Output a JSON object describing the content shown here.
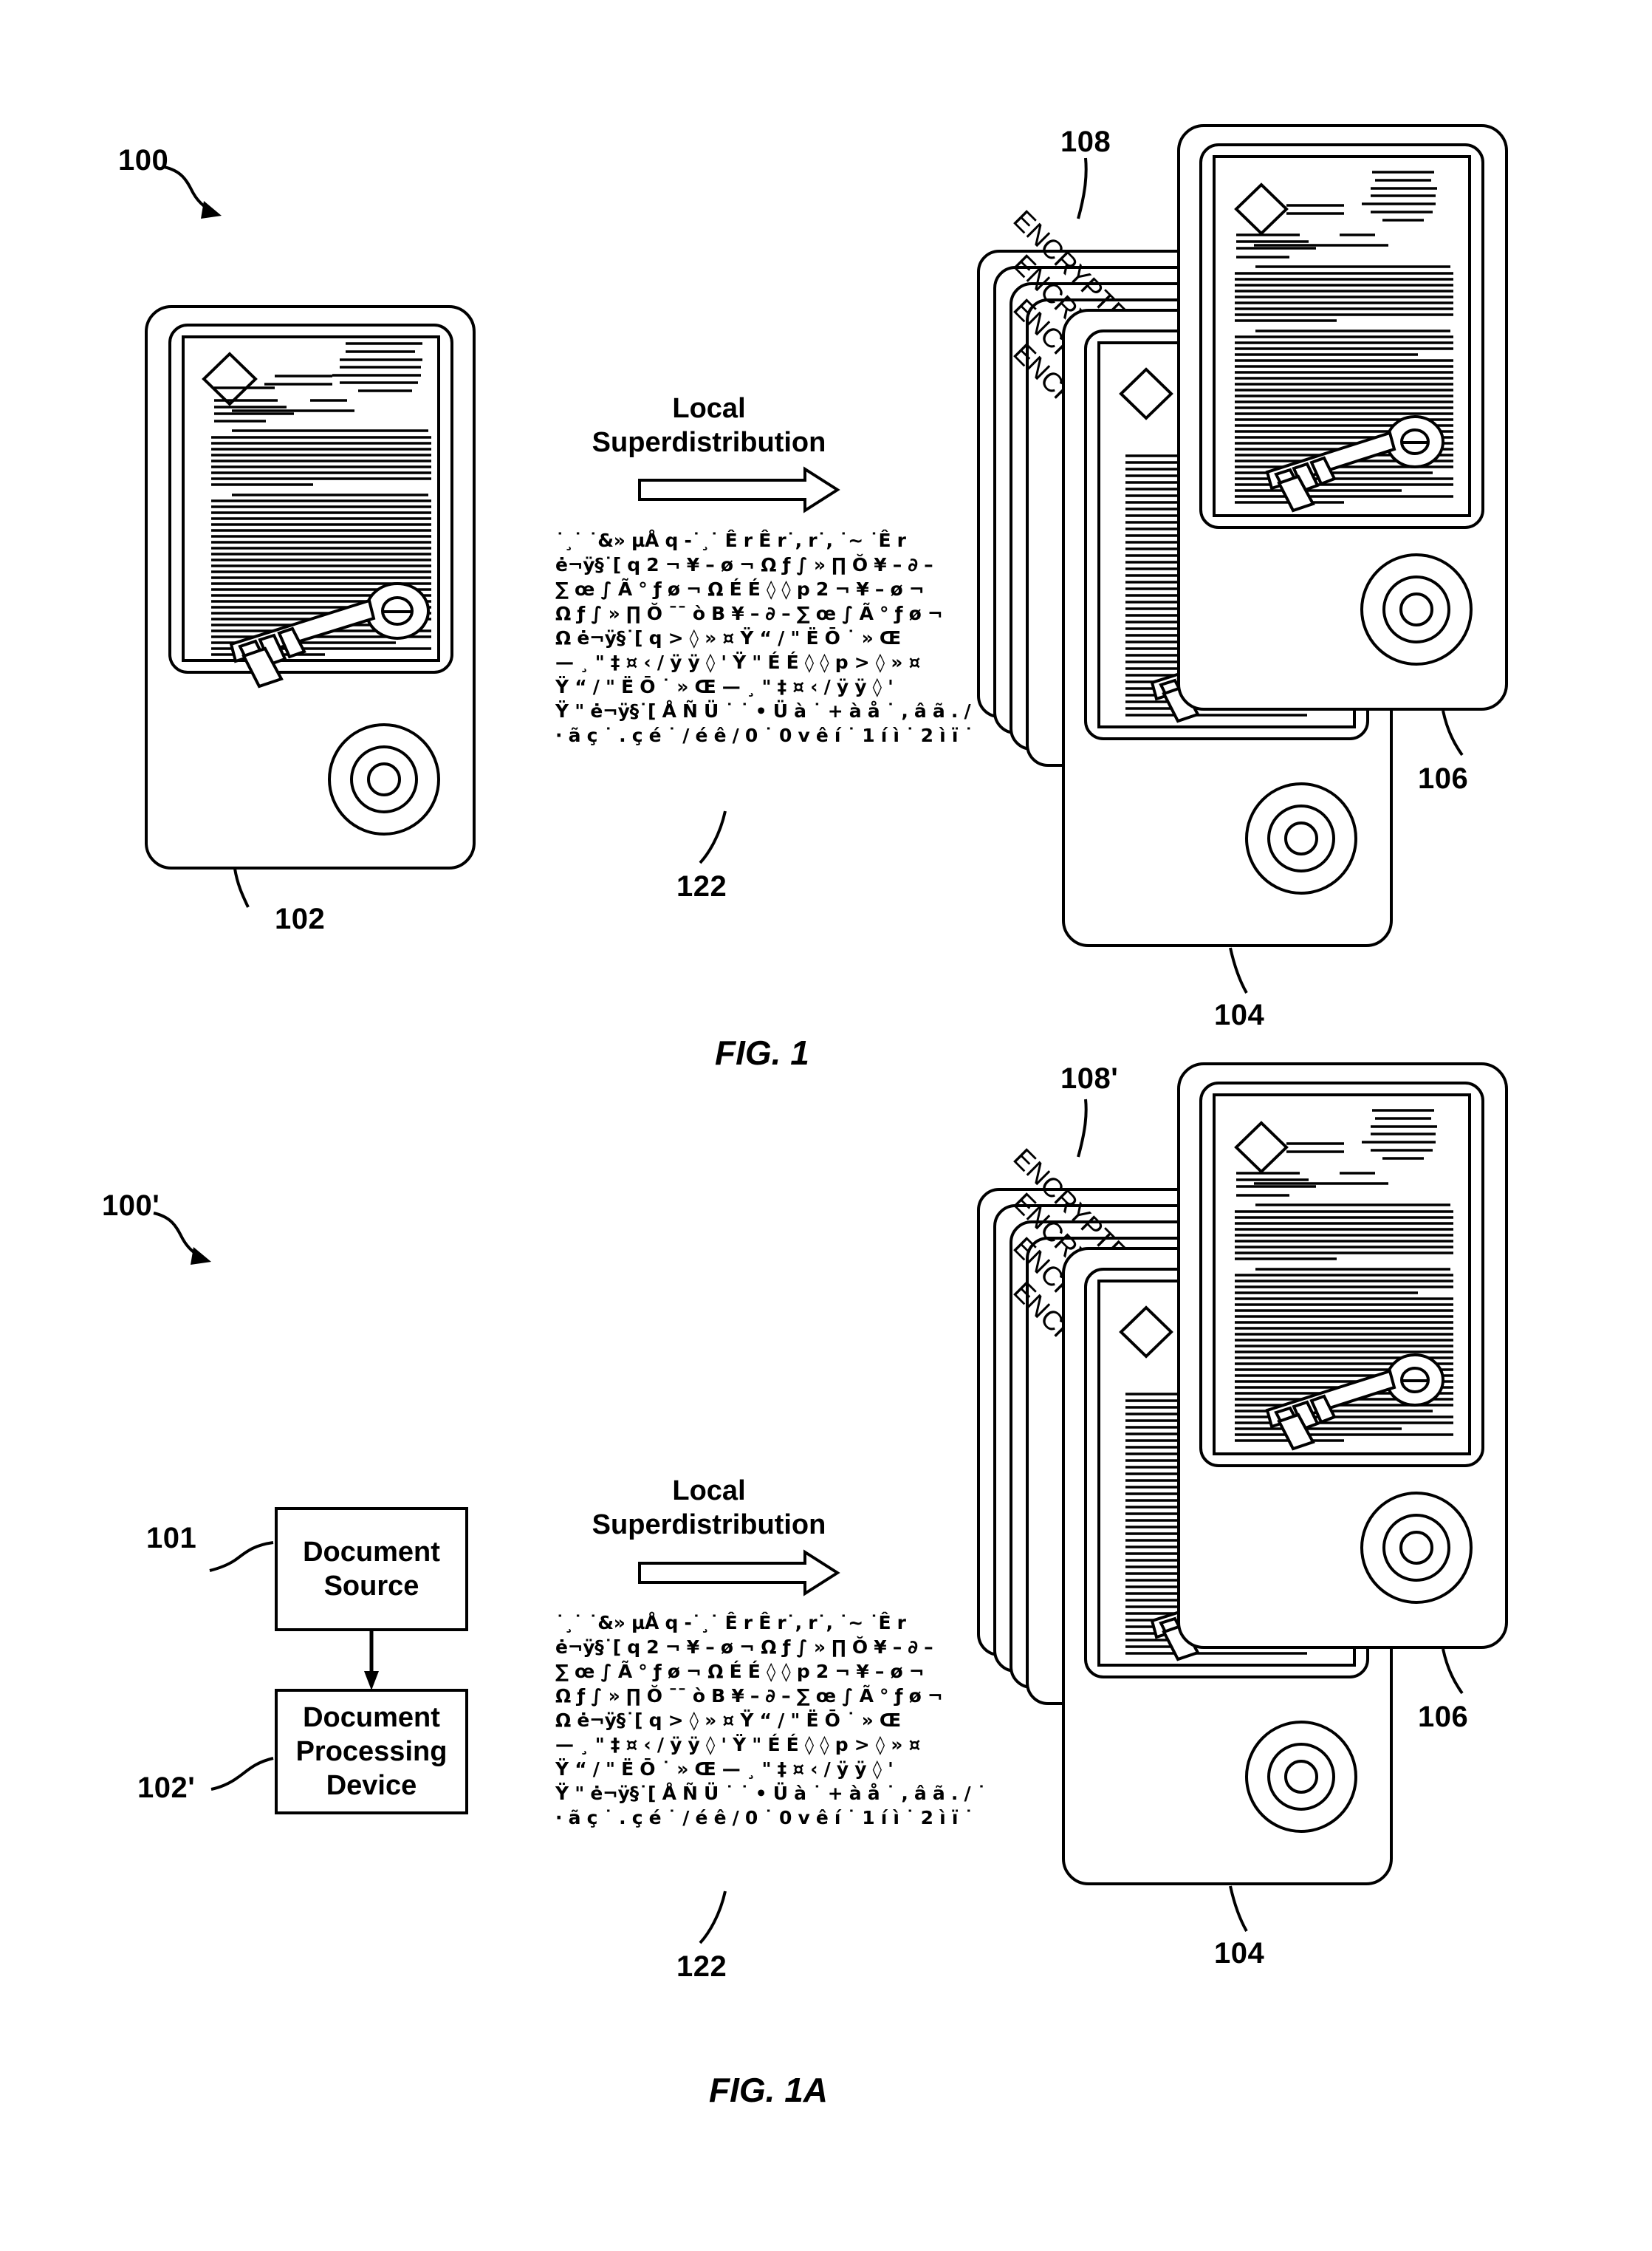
{
  "figures": [
    {
      "id": "fig1",
      "caption": "FIG. 1",
      "system_ref": "100",
      "source_device_ref": "102",
      "target_device_ref": "104",
      "top_device_ref": "106",
      "encrypted_stack_ref": "108",
      "cipher_ref": "122",
      "distribution_label_line1": "Local",
      "distribution_label_line2": "Superdistribution",
      "encrypted_stack_labels": [
        "ENCRYPTED",
        "ENCRYPT",
        "ENCR",
        "ENCR"
      ],
      "cipher_lines": [
        "˙¸˙ ˙&» µÅ q -˙¸˙ Ê r Ê r˙, r˙, ˙~ ˙Ê r",
        "ė¬ÿ§˙[ q 2 ¬ ¥ – ø ¬ Ω ƒ ∫ » ∏ Ŏ ¥ – ∂ –",
        "∑ œ ∫ Ã ° ƒ ø ¬ Ω  É É ◊ ◊ p 2 ¬ ¥ – ø ¬",
        "Ω ƒ ∫ » ∏ Ŏ ¯¯ ò B ¥ – ∂ – ∑ œ ∫ Ã ° ƒ ø ¬",
        "Ω  ė¬ÿ§˙[ q > ◊ »  ¤ Ÿ “ / \" Ë Ō ˙ »    Œ",
        "— ¸ \" ‡ ¤ ‹ / ÿ ÿ ◊ ' Ÿ \"  É É ◊ ◊ p > ◊ »  ¤",
        "Ÿ “ / \" Ë Ō ˙ »    Œ  — ¸ \" ‡ ¤ ‹ / ÿ ÿ ◊ '",
        "Ÿ \"  ė¬ÿ§˙[ Å Ñ Ü ˙ ˙ • Ü à ˙ + à å ˙ , â ã . / ˙",
        "· ã ç ˙ . ç é ˙ / é ê / 0 ˙ 0 v ê í ˙ 1 í ì ˙ 2 ì ï ˙"
      ]
    },
    {
      "id": "fig1a",
      "caption": "FIG. 1A",
      "system_ref": "100'",
      "document_source_ref": "101",
      "document_source_label_line1": "Document",
      "document_source_label_line2": "Source",
      "processing_device_ref": "102'",
      "processing_device_label_line1": "Document",
      "processing_device_label_line2": "Processing",
      "processing_device_label_line3": "Device",
      "target_device_ref": "104",
      "top_device_ref": "106",
      "encrypted_stack_ref": "108'",
      "cipher_ref": "122",
      "distribution_label_line1": "Local",
      "distribution_label_line2": "Superdistribution",
      "encrypted_stack_labels": [
        "ENCRYPTED",
        "ENCRYPT",
        "ENCR",
        "ENCR"
      ],
      "cipher_lines": [
        "˙¸˙ ˙&» µÅ q -˙¸˙ Ê r Ê r˙, r˙, ˙~ ˙Ê r",
        "ė¬ÿ§˙[ q 2 ¬ ¥ – ø ¬ Ω ƒ ∫ » ∏ Ŏ ¥ – ∂ –",
        "∑ œ ∫ Ã ° ƒ ø ¬ Ω  É É ◊ ◊ p 2 ¬ ¥ – ø ¬",
        "Ω ƒ ∫ » ∏ Ŏ ¯¯ ò B ¥ – ∂ – ∑ œ ∫ Ã ° ƒ ø ¬",
        "Ω  ė¬ÿ§˙[ q > ◊ »  ¤ Ÿ “ / \" Ë Ō ˙ »    Œ",
        "— ¸ \" ‡ ¤ ‹ / ÿ ÿ ◊ ' Ÿ \"  É É ◊ ◊ p > ◊ »  ¤",
        "Ÿ “ / \" Ë Ō ˙ »    Œ  — ¸ \" ‡ ¤ ‹ / ÿ ÿ ◊ '",
        "Ÿ \"  ė¬ÿ§˙[ Å Ñ Ü ˙ ˙ • Ü à ˙ + à å ˙ , â ã . / ˙",
        "· ã ç ˙ . ç é ˙ / é ê / 0 ˙ 0 v ê í ˙ 1 í ì ˙ 2 ì ï ˙"
      ]
    }
  ],
  "colors": {
    "ink": "#000000",
    "paper": "#ffffff"
  }
}
